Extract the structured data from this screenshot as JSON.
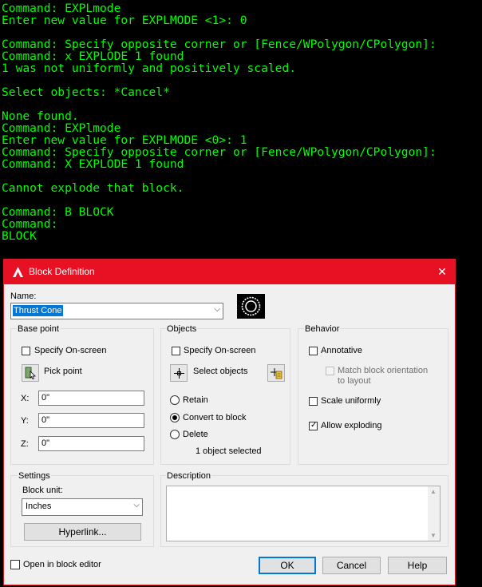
{
  "console": {
    "lines": [
      "Command: EXPLmode",
      "Enter new value for EXPLMODE <1>: 0",
      "",
      "Command: Specify opposite corner or [Fence/WPolygon/CPolygon]:",
      "Command: x EXPLODE 1 found",
      "1 was not uniformly and positively scaled.",
      "",
      "Select objects: *Cancel*",
      "",
      "None found.",
      "Command: EXPlmode",
      "Enter new value for EXPLMODE <0>: 1",
      "Command: Specify opposite corner or [Fence/WPolygon/CPolygon]:",
      "Command: X EXPLODE 1 found",
      "",
      "Cannot explode that block.",
      "",
      "Command: B BLOCK",
      "Command:",
      "BLOCK"
    ]
  },
  "dialog": {
    "title": "Block Definition",
    "close": "✕",
    "name_label": "Name:",
    "name_value": "Thrust Cone",
    "base_point": {
      "title": "Base point",
      "specify_label": "Specify On-screen",
      "specify_checked": false,
      "pick_label": "Pick point",
      "x_label": "X:",
      "x_value": "0\"",
      "y_label": "Y:",
      "y_value": "0\"",
      "z_label": "Z:",
      "z_value": "0\""
    },
    "objects": {
      "title": "Objects",
      "specify_label": "Specify On-screen",
      "specify_checked": false,
      "select_label": "Select objects",
      "retain_label": "Retain",
      "convert_label": "Convert to block",
      "delete_label": "Delete",
      "selected_option": "Convert to block",
      "status": "1 object selected"
    },
    "behavior": {
      "title": "Behavior",
      "annotative_label": "Annotative",
      "match_label_1": "Match block orientation",
      "match_label_2": "to layout",
      "scale_label": "Scale uniformly",
      "explode_label": "Allow exploding",
      "allow_exploding_checked": true
    },
    "settings": {
      "title": "Settings",
      "unit_label": "Block unit:",
      "unit_value": "Inches",
      "hyperlink_label": "Hyperlink..."
    },
    "description": {
      "title": "Description",
      "value": ""
    },
    "open_editor_label": "Open in block editor",
    "ok_label": "OK",
    "cancel_label": "Cancel",
    "help_label": "Help"
  },
  "colors": {
    "console_text": "#00ff00",
    "titlebar": "#e81123",
    "default_button_border": "#0078d7"
  }
}
